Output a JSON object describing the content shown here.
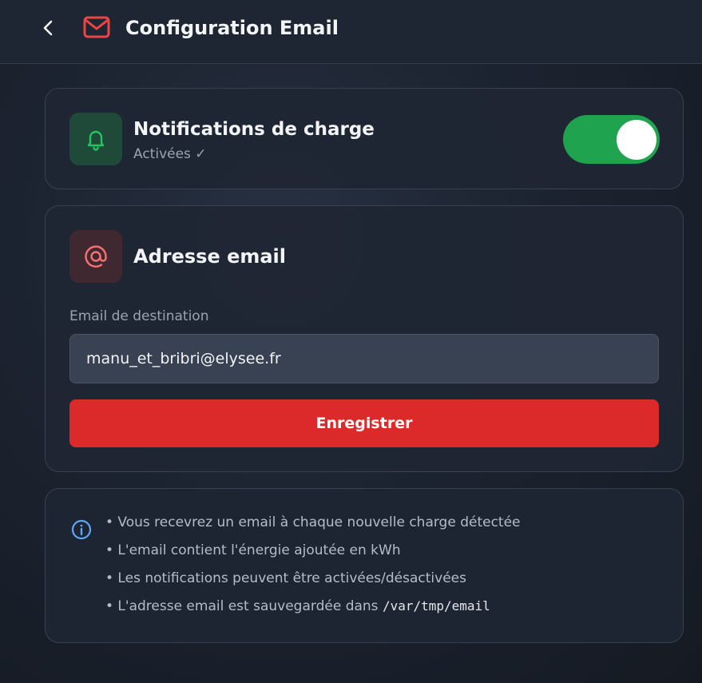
{
  "header": {
    "title": "Configuration Email",
    "back_icon": "chevron-left-icon",
    "title_icon": "mail-icon",
    "accent_color": "#ef4444"
  },
  "notifications": {
    "title": "Notifications de charge",
    "status": "Activées ✓",
    "icon": "bell-icon",
    "toggle_on": true,
    "toggle_color": "#1fa34f"
  },
  "email_section": {
    "title": "Adresse email",
    "icon": "at-sign-icon",
    "field_label": "Email de destination",
    "email_value": "manu_et_bribri@elysee.fr",
    "save_label": "Enregistrer",
    "save_color": "#dc2a2a"
  },
  "info": {
    "icon": "info-icon",
    "items": [
      "• Vous recevrez un email à chaque nouvelle charge détectée",
      "• L'email contient l'énergie ajoutée en kWh",
      "• Les notifications peuvent être activées/désactivées",
      "• L'adresse email est sauvegardée dans "
    ],
    "path": "/var/tmp/email"
  }
}
